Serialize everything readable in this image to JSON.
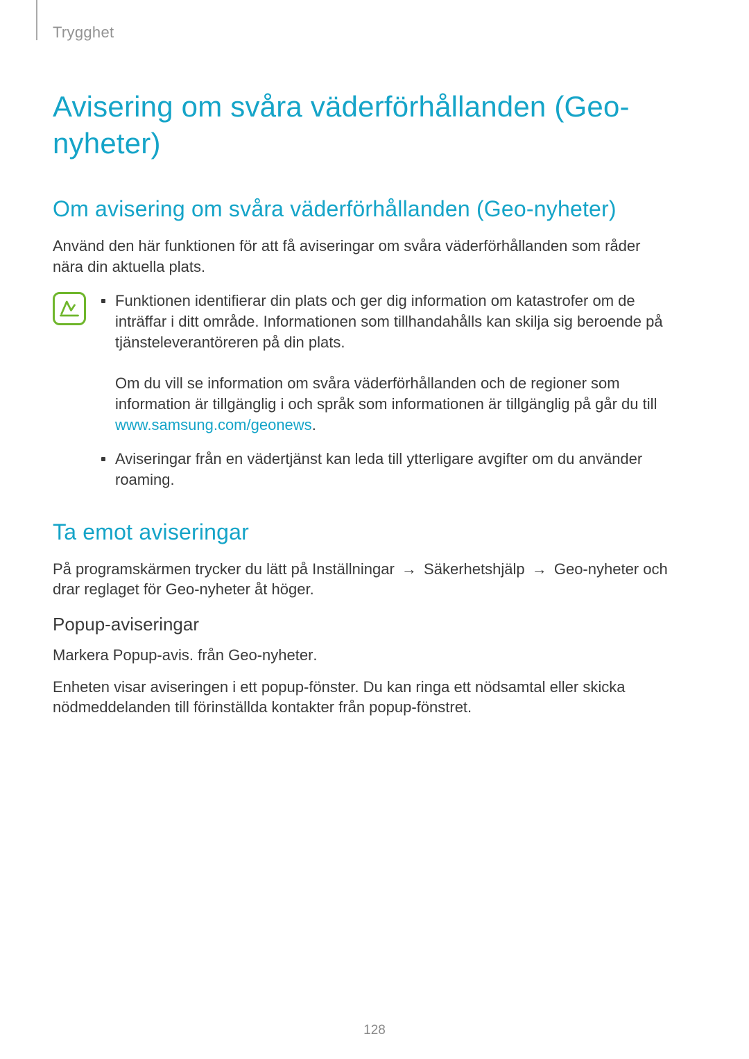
{
  "breadcrumb": "Trygghet",
  "h1": "Avisering om svåra väderförhållanden (Geo-nyheter)",
  "section_about": {
    "heading": "Om avisering om svåra väderförhållanden (Geo-nyheter)",
    "intro": "Använd den här funktionen för att få aviseringar om svåra väderförhållanden som råder nära din aktuella plats.",
    "note_items": {
      "item1_a": "Funktionen identifierar din plats och ger dig information om katastrofer om de inträffar i ditt område. Informationen som tillhandahålls kan skilja sig beroende på tjänsteleverantöreren på din plats.",
      "item1_b": "Om du vill se information om svåra väderförhållanden och de regioner som information är tillgänglig i och språk som informationen är tillgänglig på går du till ",
      "item1_link": "www.samsung.com/geonews",
      "item1_period": ".",
      "item2": "Aviseringar från en vädertjänst kan leda till ytterligare avgifter om du använder roaming."
    }
  },
  "section_receive": {
    "heading": "Ta emot aviseringar",
    "intro_a": "På programskärmen trycker du lätt på ",
    "path_settings": "Inställningar",
    "arrow": "→",
    "path_safety": "Säkerhetshjälp",
    "path_geo": "Geo-nyheter",
    "intro_b": " och drar reglaget för ",
    "intro_geo2": "Geo-nyheter",
    "intro_c": " åt höger.",
    "sub_heading": "Popup-aviseringar",
    "sub_p1_a": "Markera ",
    "sub_p1_b": "Popup-avis. från Geo-nyheter",
    "sub_p1_c": ".",
    "sub_p2": "Enheten visar aviseringen i ett popup-fönster. Du kan ringa ett nödsamtal eller skicka nödmeddelanden till förinställda kontakter från popup-fönstret."
  },
  "page_number": "128"
}
